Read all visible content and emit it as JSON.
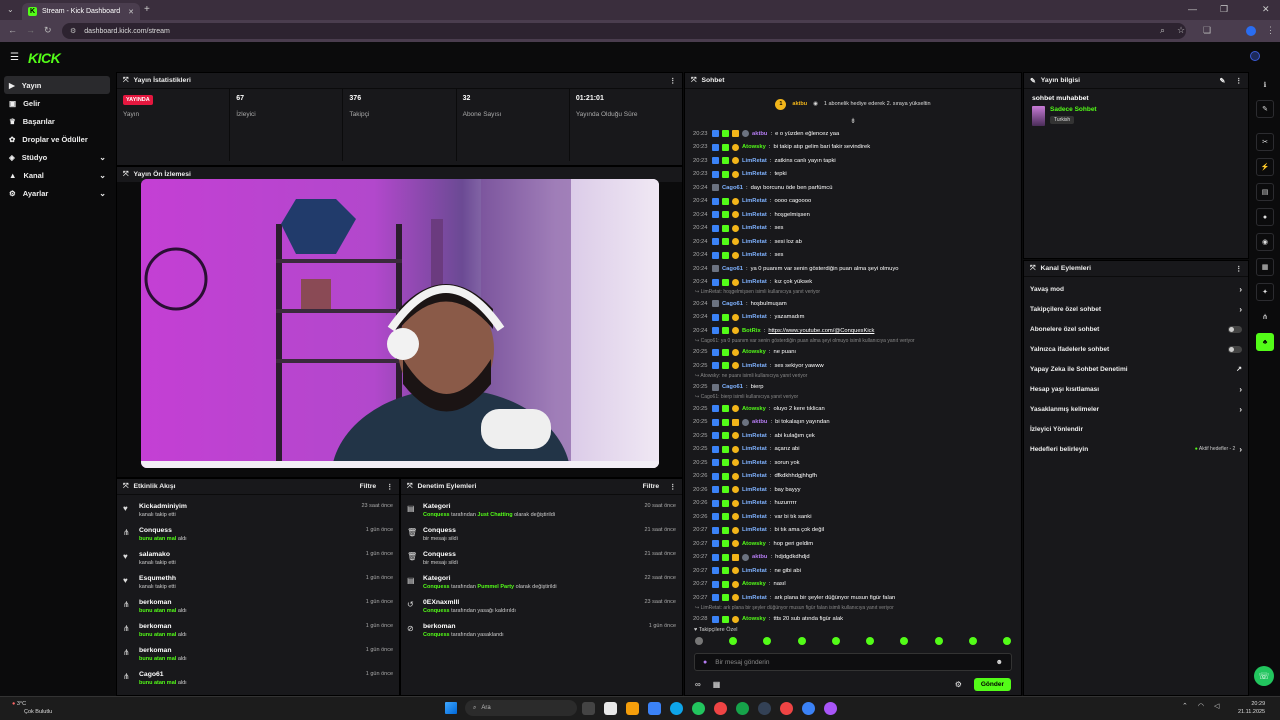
{
  "browser": {
    "tab_title": "Stream - Kick Dashboard",
    "url": "dashboard.kick.com/stream"
  },
  "logo": "KICK",
  "sidebar": {
    "items": [
      {
        "label": "Yayın",
        "icon": "video-icon",
        "active": true,
        "chevron": false
      },
      {
        "label": "Gelir",
        "icon": "money-icon",
        "active": false,
        "chevron": false
      },
      {
        "label": "Başarılar",
        "icon": "trophy-icon",
        "active": false,
        "chevron": false
      },
      {
        "label": "Droplar ve Ödüller",
        "icon": "gift-icon",
        "active": false,
        "chevron": false
      },
      {
        "label": "Stüdyo",
        "icon": "studio-icon",
        "active": false,
        "chevron": true
      },
      {
        "label": "Kanal",
        "icon": "channel-icon",
        "active": false,
        "chevron": true
      },
      {
        "label": "Ayarlar",
        "icon": "settings-icon",
        "active": false,
        "chevron": true
      }
    ]
  },
  "stats_panel": {
    "title": "Yayın İstatistikleri",
    "items": [
      {
        "value": "YAYINDA",
        "label": "Yayın",
        "is_badge": true
      },
      {
        "value": "67",
        "label": "İzleyici"
      },
      {
        "value": "376",
        "label": "Takipçi"
      },
      {
        "value": "32",
        "label": "Abone Sayısı"
      },
      {
        "value": "01:21:01",
        "label": "Yayında Olduğu Süre"
      }
    ]
  },
  "preview_panel": {
    "title": "Yayın Ön İzlemesi"
  },
  "activity_panel": {
    "title": "Etkinlik Akışı",
    "filter": "Filtre",
    "items": [
      {
        "name": "Kickadminiyim",
        "sub": "kanalı takip etti",
        "sub_hl": "",
        "time": "23 saat önce",
        "icon": "heart-icon"
      },
      {
        "name": "Conquess",
        "sub": "aldı",
        "sub_hl": "bunu atan mal",
        "time": "1 gün önce",
        "icon": "share-icon"
      },
      {
        "name": "salamako",
        "sub": "kanalı takip etti",
        "sub_hl": "",
        "time": "1 gün önce",
        "icon": "heart-icon"
      },
      {
        "name": "Esqumethh",
        "sub": "kanalı takip etti",
        "sub_hl": "",
        "time": "1 gün önce",
        "icon": "heart-icon"
      },
      {
        "name": "berkoman",
        "sub": "aldı",
        "sub_hl": "bunu atan mal",
        "time": "1 gün önce",
        "icon": "share-icon"
      },
      {
        "name": "berkoman",
        "sub": "aldı",
        "sub_hl": "bunu atan mal",
        "time": "1 gün önce",
        "icon": "share-icon"
      },
      {
        "name": "berkoman",
        "sub": "aldı",
        "sub_hl": "bunu atan mal",
        "time": "1 gün önce",
        "icon": "share-icon"
      },
      {
        "name": "Cago61",
        "sub": "aldı",
        "sub_hl": "bunu atan mal",
        "time": "1 gün önce",
        "icon": "share-icon"
      }
    ]
  },
  "moderation_panel": {
    "title": "Denetim Eylemleri",
    "filter": "Filtre",
    "items": [
      {
        "name": "Kategori",
        "actor": "Conquess",
        "mid": " tarafından ",
        "hl": "Just Chatting",
        "tail": " olarak değiştirildi",
        "time": "20 saat önce",
        "icon": "category-icon"
      },
      {
        "name": "Conquess",
        "actor": "",
        "mid": "",
        "hl": "",
        "tail": "bir mesajı sildi",
        "time": "21 saat önce",
        "icon": "trash-icon"
      },
      {
        "name": "Conquess",
        "actor": "",
        "mid": "",
        "hl": "",
        "tail": "bir mesajı sildi",
        "time": "21 saat önce",
        "icon": "trash-icon"
      },
      {
        "name": "Kategori",
        "actor": "Conquess",
        "mid": " tarafından ",
        "hl": "Pummel Party",
        "tail": " olarak değiştirildi",
        "time": "22 saat önce",
        "icon": "category-icon"
      },
      {
        "name": "0EXnaxmlll",
        "actor": "Conquess",
        "mid": "",
        "hl": "",
        "tail": " tarafından yasağı kaldırıldı",
        "time": "23 saat önce",
        "icon": "unban-icon"
      },
      {
        "name": "berkoman",
        "actor": "Conquess",
        "mid": "",
        "hl": "",
        "tail": " tarafından yasaklandı",
        "time": "1 gün önce",
        "icon": "ban-icon"
      }
    ]
  },
  "chat": {
    "title": "Sohbet",
    "pinned_user": "aktbu",
    "pinned_rank": "1",
    "gift_notice": "1 abonelik hediye ederek 2. sıraya yükseltin",
    "lines": [
      {
        "type": "msg",
        "time": "20:23",
        "user": "aktbu",
        "color": "#b57cf2",
        "badges": 4,
        "text": "e o yüzden eğlencez yaa"
      },
      {
        "type": "msg",
        "time": "20:23",
        "user": "Atowsky",
        "color": "#53fc18",
        "badges": 3,
        "text": "bi takip atıp gelim bari fakir sevindirek"
      },
      {
        "type": "msg",
        "time": "20:23",
        "user": "LimRetat",
        "color": "#7fb2ff",
        "badges": 3,
        "text": "zatkins canlı yayın tapki"
      },
      {
        "type": "msg",
        "time": "20:23",
        "user": "LimRetat",
        "color": "#7fb2ff",
        "badges": 3,
        "text": "tepki"
      },
      {
        "type": "msg",
        "time": "20:24",
        "user": "Cago61",
        "color": "#7fb2ff",
        "badges": 1,
        "text": "dayı borcunu öde ben parfümcü"
      },
      {
        "type": "msg",
        "time": "20:24",
        "user": "LimRetat",
        "color": "#7fb2ff",
        "badges": 3,
        "text": "oooo cagoooo"
      },
      {
        "type": "msg",
        "time": "20:24",
        "user": "LimRetat",
        "color": "#7fb2ff",
        "badges": 3,
        "text": "hoşgelmişsen"
      },
      {
        "type": "msg",
        "time": "20:24",
        "user": "LimRetat",
        "color": "#7fb2ff",
        "badges": 3,
        "text": "ses"
      },
      {
        "type": "msg",
        "time": "20:24",
        "user": "LimRetat",
        "color": "#7fb2ff",
        "badges": 3,
        "text": "sesi loz ab"
      },
      {
        "type": "msg",
        "time": "20:24",
        "user": "LimRetat",
        "color": "#7fb2ff",
        "badges": 3,
        "text": "ses"
      },
      {
        "type": "msg",
        "time": "20:24",
        "user": "Cago61",
        "color": "#7fb2ff",
        "badges": 1,
        "text": "ya 0 puanım var senin gösterdiğin puan alma şeyi olmuyo"
      },
      {
        "type": "msg",
        "time": "20:24",
        "user": "LimRetat",
        "color": "#7fb2ff",
        "badges": 3,
        "text": "kız çok yüksek"
      },
      {
        "type": "reply",
        "text": "LimRetat: hoşgelmişsen isimli kullanıcıya yanıt veriyor"
      },
      {
        "type": "msg",
        "time": "20:24",
        "user": "Cago61",
        "color": "#7fb2ff",
        "badges": 1,
        "text": "hoşbulmuşam"
      },
      {
        "type": "msg",
        "time": "20:24",
        "user": "LimRetat",
        "color": "#7fb2ff",
        "badges": 3,
        "text": "yazamadım"
      },
      {
        "type": "msg",
        "time": "20:24",
        "user": "BotRix",
        "color": "#53fc18",
        "badges": 3,
        "text": "https://www.youtube.com/@ConquesKick"
      },
      {
        "type": "reply",
        "text": "Cago61: ya 0 puanım var senin gösterdiğin puan alma şeyi olmuyo isimli kullanıcıya yanıt veriyor"
      },
      {
        "type": "msg",
        "time": "20:25",
        "user": "Atowsky",
        "color": "#53fc18",
        "badges": 3,
        "text": "ne puanı"
      },
      {
        "type": "msg",
        "time": "20:25",
        "user": "LimRetat",
        "color": "#7fb2ff",
        "badges": 3,
        "text": "ses sekiyor yawww"
      },
      {
        "type": "reply",
        "text": "Atowsky: ne puanı isimli kullanıcıya yanıt veriyor"
      },
      {
        "type": "msg",
        "time": "20:25",
        "user": "Cago61",
        "color": "#7fb2ff",
        "badges": 1,
        "text": "bierp"
      },
      {
        "type": "reply",
        "text": "Cago61: bierp isimli kullanıcıya yanıt veriyor"
      },
      {
        "type": "msg",
        "time": "20:25",
        "user": "Atowsky",
        "color": "#53fc18",
        "badges": 3,
        "text": "oluyo 2 kere tıklican"
      },
      {
        "type": "msg",
        "time": "20:25",
        "user": "aktbu",
        "color": "#b57cf2",
        "badges": 4,
        "text": "bi tokalaşın yayından"
      },
      {
        "type": "msg",
        "time": "20:25",
        "user": "LimRetat",
        "color": "#7fb2ff",
        "badges": 3,
        "text": "abi kulağım çek"
      },
      {
        "type": "msg",
        "time": "20:25",
        "user": "LimRetat",
        "color": "#7fb2ff",
        "badges": 3,
        "text": "açarız abi"
      },
      {
        "type": "msg",
        "time": "20:25",
        "user": "LimRetat",
        "color": "#7fb2ff",
        "badges": 3,
        "text": "sorun yok"
      },
      {
        "type": "msg",
        "time": "20:26",
        "user": "LimRetat",
        "color": "#7fb2ff",
        "badges": 3,
        "text": "dfkdkhhdgjhhgfh"
      },
      {
        "type": "msg",
        "time": "20:26",
        "user": "LimRetat",
        "color": "#7fb2ff",
        "badges": 3,
        "text": "bay bayyy"
      },
      {
        "type": "msg",
        "time": "20:26",
        "user": "LimRetat",
        "color": "#7fb2ff",
        "badges": 3,
        "text": "huzurrrrr"
      },
      {
        "type": "msg",
        "time": "20:26",
        "user": "LimRetat",
        "color": "#7fb2ff",
        "badges": 3,
        "text": "var bi tık sanki"
      },
      {
        "type": "msg",
        "time": "20:27",
        "user": "LimRetat",
        "color": "#7fb2ff",
        "badges": 3,
        "text": "bi tık ama çok değil"
      },
      {
        "type": "msg",
        "time": "20:27",
        "user": "Atowsky",
        "color": "#53fc18",
        "badges": 3,
        "text": "hop geri geldim"
      },
      {
        "type": "msg",
        "time": "20:27",
        "user": "aktbu",
        "color": "#b57cf2",
        "badges": 4,
        "text": "hdjdgdkdhdjd"
      },
      {
        "type": "msg",
        "time": "20:27",
        "user": "LimRetat",
        "color": "#7fb2ff",
        "badges": 3,
        "text": "ne gibi abi"
      },
      {
        "type": "msg",
        "time": "20:27",
        "user": "Atowsky",
        "color": "#53fc18",
        "badges": 3,
        "text": "nasıl"
      },
      {
        "type": "msg",
        "time": "20:27",
        "user": "LimRetat",
        "color": "#7fb2ff",
        "badges": 3,
        "text": "ark plana bir şeyler düğünyor musun figür falan"
      },
      {
        "type": "reply",
        "text": "LimRetat: ark plana bir şeyler düğünyor musun figür falan isimli kullanıcıya yanıt veriyor"
      },
      {
        "type": "msg",
        "time": "20:28",
        "user": "Atowsky",
        "color": "#53fc18",
        "badges": 3,
        "text": "ttts 20 sub atında figür alak"
      }
    ],
    "followers_only": "Takipçilere Özel",
    "input_placeholder": "Bir mesaj gönderin",
    "send": "Gönder"
  },
  "stream_info": {
    "title": "Yayın bilgisi",
    "stream_title": "sohbet muhabbet",
    "category": "Sadece Sohbet",
    "language": "Turkish"
  },
  "channel_actions": {
    "title": "Kanal Eylemleri",
    "items": [
      {
        "label": "Yavaş mod",
        "control": "chevron"
      },
      {
        "label": "Takipçilere özel sohbet",
        "control": "chevron"
      },
      {
        "label": "Abonelere özel sohbet",
        "control": "toggle"
      },
      {
        "label": "Yalnızca ifadelerle sohbet",
        "control": "toggle"
      },
      {
        "label": "Yapay Zeka ile Sohbet Denetimi",
        "control": "external"
      },
      {
        "label": "Hesap yaşı kısıtlaması",
        "control": "chevron"
      },
      {
        "label": "Yasaklanmış kelimeler",
        "control": "chevron"
      },
      {
        "label": "İzleyici Yönlendir",
        "control": "none"
      },
      {
        "label": "Hedefleri belirleyin",
        "control": "goal"
      }
    ],
    "goal_status": "Aktif hedefler - 2"
  },
  "taskbar": {
    "weather_temp": "3°C",
    "weather_desc": "Çok Bulutlu",
    "search": "Ara",
    "time": "20:29",
    "date": "21.11.2025"
  },
  "colors": {
    "accent": "#53fc18",
    "live": "#e5173f"
  }
}
